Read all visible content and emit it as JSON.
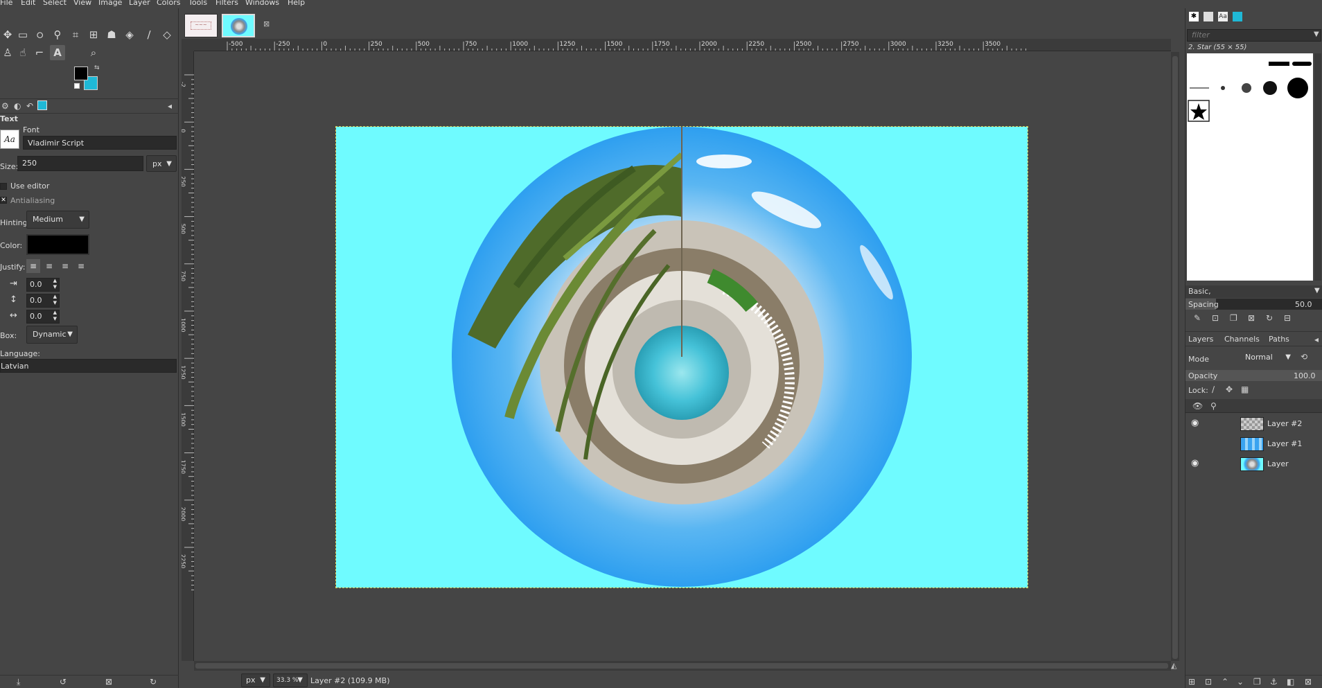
{
  "menu": [
    "File",
    "Edit",
    "Select",
    "View",
    "Image",
    "Layer",
    "Colors",
    "Tools",
    "Filters",
    "Windows",
    "Help"
  ],
  "toolbox": {
    "tools": [
      "move-icon",
      "rect-select-icon",
      "lasso-icon",
      "fuzzy-select-icon",
      "crop-icon",
      "unified-transform-icon",
      "warp-icon",
      "bucket-fill-icon",
      "paintbrush-icon",
      "eraser-icon",
      "clone-icon",
      "smudge-icon",
      "path-icon",
      "text-icon",
      "zoom-icon"
    ],
    "fg_color": "#000000",
    "bg_color": "#1fb8d6"
  },
  "tool_options": {
    "title": "Text",
    "font_label": "Font",
    "font_value": "Vladimir Script",
    "size_label": "Size:",
    "size_value": "250",
    "size_unit": "px",
    "use_editor_label": "Use editor",
    "antialiasing_label": "Antialiasing",
    "hinting_label": "Hinting:",
    "hinting_value": "Medium",
    "color_label": "Color:",
    "text_color": "#000000",
    "justify_label": "Justify:",
    "indent_value": "0.0",
    "line_spacing_value": "0.0",
    "letter_spacing_value": "0.0",
    "box_label": "Box:",
    "box_value": "Dynamic",
    "language_label": "Language:",
    "language_value": "Latvian"
  },
  "ruler": {
    "h_ticks": [
      "-500",
      "-250",
      "0",
      "250",
      "500",
      "750",
      "1000",
      "1250",
      "1500",
      "1750",
      "2000",
      "2250",
      "2500",
      "2750",
      "3000",
      "3250",
      "3500"
    ],
    "v_ticks": [
      "-2",
      "0",
      "250",
      "500",
      "750",
      "1000",
      "1250",
      "1500",
      "1750",
      "2000",
      "2250"
    ]
  },
  "status": {
    "unit": "px",
    "zoom": "33.3 %",
    "layer_info": "Layer #2 (109.9 MB)"
  },
  "brushes": {
    "filter_placeholder": "filter",
    "selected_brush": "2. Star (55 × 55)",
    "tag_value": "Basic,",
    "spacing_label": "Spacing",
    "spacing_value": "50.0"
  },
  "layers_panel": {
    "tabs": [
      "Layers",
      "Channels",
      "Paths"
    ],
    "mode_label": "Mode",
    "mode_value": "Normal",
    "opacity_label": "Opacity",
    "opacity_value": "100.0",
    "lock_label": "Lock:",
    "layers": [
      {
        "name": "Layer #2",
        "visible": true
      },
      {
        "name": "Layer #1",
        "visible": false
      },
      {
        "name": "Layer",
        "visible": true
      }
    ]
  },
  "colors": {
    "canvas_bg": "#6ffbff",
    "sky": "#35a7f5",
    "accent": "#1fb8d6"
  }
}
